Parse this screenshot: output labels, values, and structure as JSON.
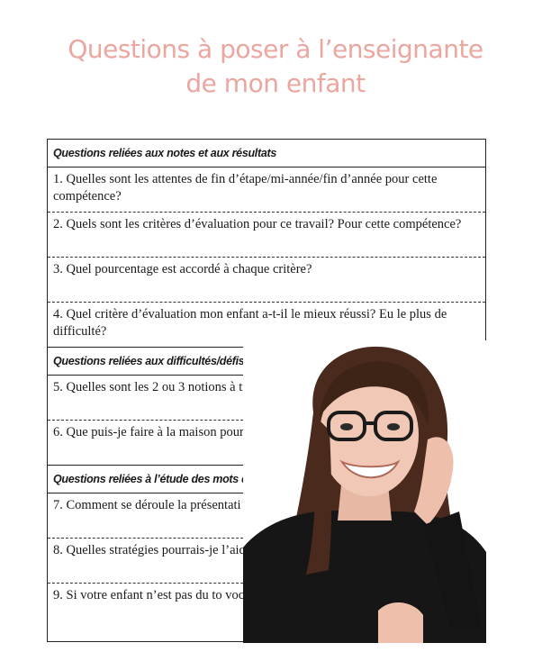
{
  "title": {
    "line1": "Questions à poser à l’enseignante",
    "line2": "de mon enfant"
  },
  "sections": [
    {
      "header": "Questions reliées aux notes et aux résultats",
      "questions": [
        "1. Quelles sont les attentes de fin d’étape/mi-année/fin d’année pour cette compétence?",
        "2. Quels sont les critères d’évaluation pour ce travail? Pour cette compétence?",
        "3. Quel pourcentage est accordé à chaque critère?",
        "4. Quel critère d’évaluation mon enfant a-t-il le mieux réussi? Eu le plus de difficulté?"
      ]
    },
    {
      "header": "Questions reliées aux difficultés/défis de mon enfant",
      "questions": [
        "5. Quelles sont les 2 ou 3 notions à travailler en",
        "6. Que puis-je faire à la maison pour l’aider à t notions?"
      ]
    },
    {
      "header": "Questions reliées à l’étude des mots de vocabulaire",
      "questions": [
        "7. Comment se déroule la présentati début de la semaine?",
        "8. Quelles stratégies pourrais-je l’aider à étudier ses mots de voc",
        "9. Si votre enfant n’est pas du to vocabulaire : quels jeux me cons vocabulaire?"
      ]
    }
  ],
  "photo": {
    "icon": "teacher-portrait"
  },
  "colors": {
    "title": "#eca6a0",
    "border": "#222222"
  }
}
